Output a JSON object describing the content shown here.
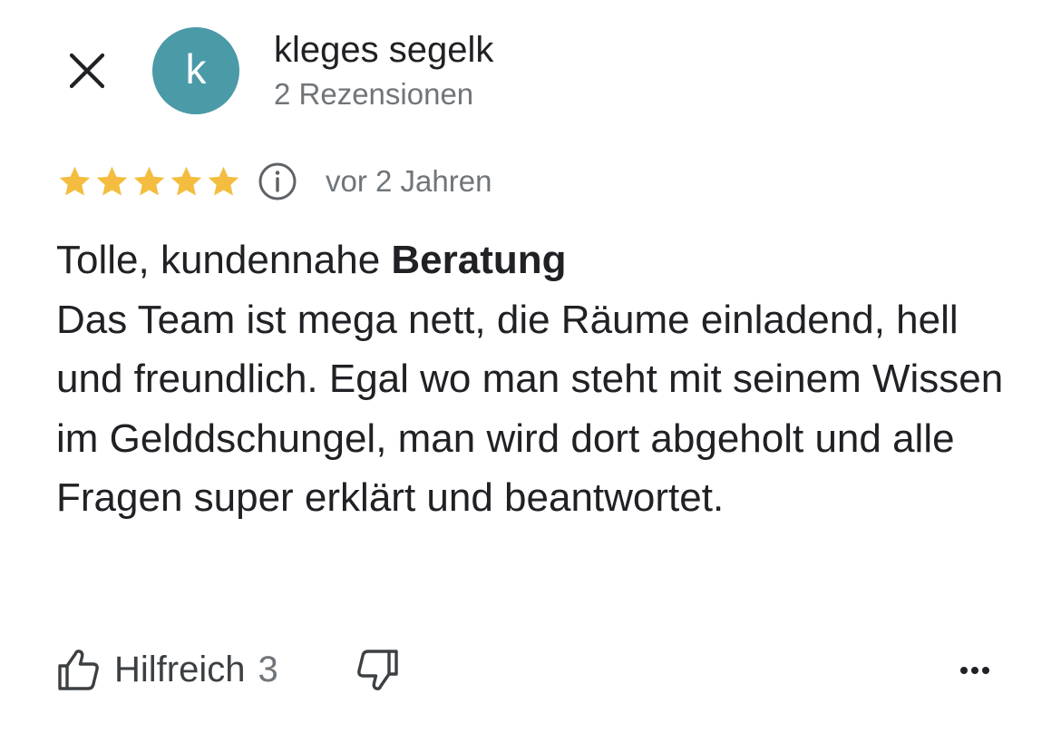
{
  "header": {
    "close_icon": "close-icon",
    "avatar_letter": "k",
    "avatar_color": "#4a9aa8",
    "reviewer_name": "kleges segelk",
    "review_count": "2 Rezensionen"
  },
  "rating": {
    "stars": 5,
    "max_stars": 5,
    "star_color": "#f4bd3f",
    "info_icon": "info-icon",
    "time": "vor 2 Jahren"
  },
  "review": {
    "title_prefix": "Tolle, kundennahe ",
    "title_bold": "Beratung",
    "body": "Das Team ist mega nett, die Räume einladend, hell und freundlich. Egal wo man steht mit seinem Wissen im Gelddschungel, man wird dort abgeholt und alle Fragen super erklärt und beantwortet."
  },
  "actions": {
    "helpful_icon": "thumb-up-icon",
    "helpful_label": "Hilfreich",
    "helpful_count": "3",
    "not_helpful_icon": "thumb-down-icon",
    "more_icon": "more-horizontal-icon"
  }
}
